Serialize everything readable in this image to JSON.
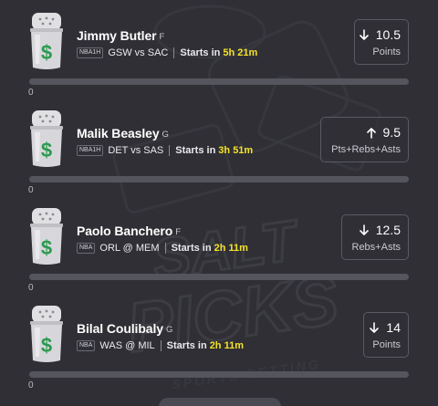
{
  "props": [
    {
      "player": "Jimmy Butler",
      "position": "F",
      "league": "NBA1H",
      "matchup": "GSW vs SAC",
      "starts_label": "Starts in",
      "starts_time": "5h 21m",
      "direction": "down",
      "value": "10.5",
      "stat": "Points",
      "count": "0"
    },
    {
      "player": "Malik Beasley",
      "position": "G",
      "league": "NBA1H",
      "matchup": "DET vs SAS",
      "starts_label": "Starts in",
      "starts_time": "3h 51m",
      "direction": "up",
      "value": "9.5",
      "stat": "Pts+Rebs+Asts",
      "count": "0"
    },
    {
      "player": "Paolo Banchero",
      "position": "F",
      "league": "NBA",
      "matchup": "ORL @ MEM",
      "starts_label": "Starts in",
      "starts_time": "2h 11m",
      "direction": "down",
      "value": "12.5",
      "stat": "Rebs+Asts",
      "count": "0"
    },
    {
      "player": "Bilal Coulibaly",
      "position": "G",
      "league": "NBA",
      "matchup": "WAS @ MIL",
      "starts_label": "Starts in",
      "starts_time": "2h 11m",
      "direction": "down",
      "value": "14",
      "stat": "Points",
      "count": "0"
    }
  ],
  "watermark": {
    "line1": "SALT",
    "line2": "PICKS",
    "line3": "SPORTS BETTING"
  },
  "colors": {
    "background": "#2f2f35",
    "time_highlight": "#f5e22a",
    "border": "#5a5a64",
    "progress_track": "#55555d"
  },
  "icons": {
    "shaker": "salt-shaker-icon",
    "down": "arrow-down-icon",
    "up": "arrow-up-icon"
  }
}
